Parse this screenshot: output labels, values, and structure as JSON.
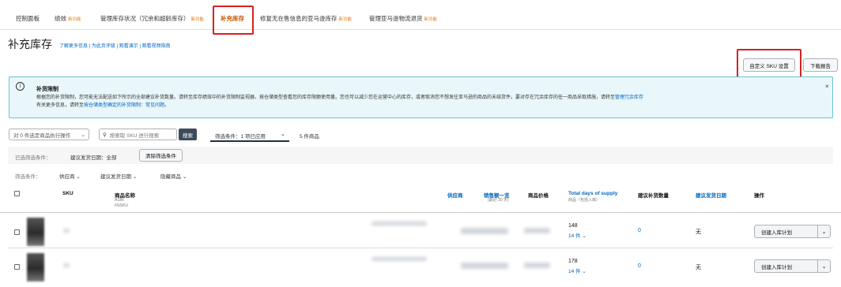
{
  "tabs": [
    {
      "label": "控制面板",
      "badge": ""
    },
    {
      "label": "绩效",
      "badge": "新功能"
    },
    {
      "label": "管理库存状况（冗余和超龄库存）",
      "badge": "新功能"
    },
    {
      "label": "补充库存",
      "badge": ""
    },
    {
      "label": "修复无在售信息的亚马逊库存",
      "badge": "新功能"
    },
    {
      "label": "管理亚马逊物流退货",
      "badge": "新功能"
    }
  ],
  "page": {
    "title": "补充库存",
    "links": "了解更多信息 | 为此页评级 | 观看演示 | 观看视频指南"
  },
  "header_buttons": {
    "custom_sku": "自定义 SKU 设置",
    "download": "下载报告"
  },
  "alert": {
    "icon": "i",
    "title": "补货限制",
    "line1": "根据您的补货限制，您可能无法配送如下所示的全部建议补货数量。请转至库存绩效中的补货限制监视器，按仓储类型查看您的库存限额使用量。您也可以减少您在运营中心的库存，或者取消您不想发往亚马逊的商品的未结货件。要对存在冗余库存的任一商品采取措施，请转至",
    "line1_link": "管理冗余库存",
    "line2a": "有关更多信息，请转至",
    "line2_link": "按仓储类型确定的补货限制：常见问题",
    "line2b": "。",
    "close": "×"
  },
  "filters": {
    "bulk_action": "对 0 件选定商品执行操作",
    "search_placeholder": "按索取 SKU 进行搜索",
    "search_button": "搜索",
    "filter_label": "筛选条件：",
    "filter_applied": "1 项已应用",
    "count": "5 件商品",
    "selected_label": "已选筛选条件：",
    "selected_value": "建议发货日期：全部",
    "clear_button": "清除筛选条件",
    "criteria_label": "筛选条件：",
    "criteria": [
      "供应商",
      "建议发货日期",
      "隐藏商品"
    ]
  },
  "table": {
    "headers": {
      "sku": "SKU",
      "name": "商品名称",
      "name_sub1": "ASIN",
      "name_sub2": "FNSKU",
      "supplier": "供应商",
      "sales": "销售额一览",
      "sales_sub": "(最近 30 天)",
      "price": "商品价格",
      "supply": "Total days of supply",
      "supply_sub": "商品（包括入库）",
      "qty": "建议补货数量",
      "date": "建议发货日期",
      "action": "操作"
    },
    "rows": [
      {
        "days": "148",
        "units": "14 件",
        "qty": "0",
        "date": "无",
        "action": "创建入库计划"
      },
      {
        "days": "178",
        "units": "14 件",
        "qty": "0",
        "date": "无",
        "action": "创建入库计划"
      }
    ]
  },
  "colors": {
    "highlight": "#d6211f",
    "link": "#0066c0",
    "alert_bg": "#e9f6fa"
  }
}
